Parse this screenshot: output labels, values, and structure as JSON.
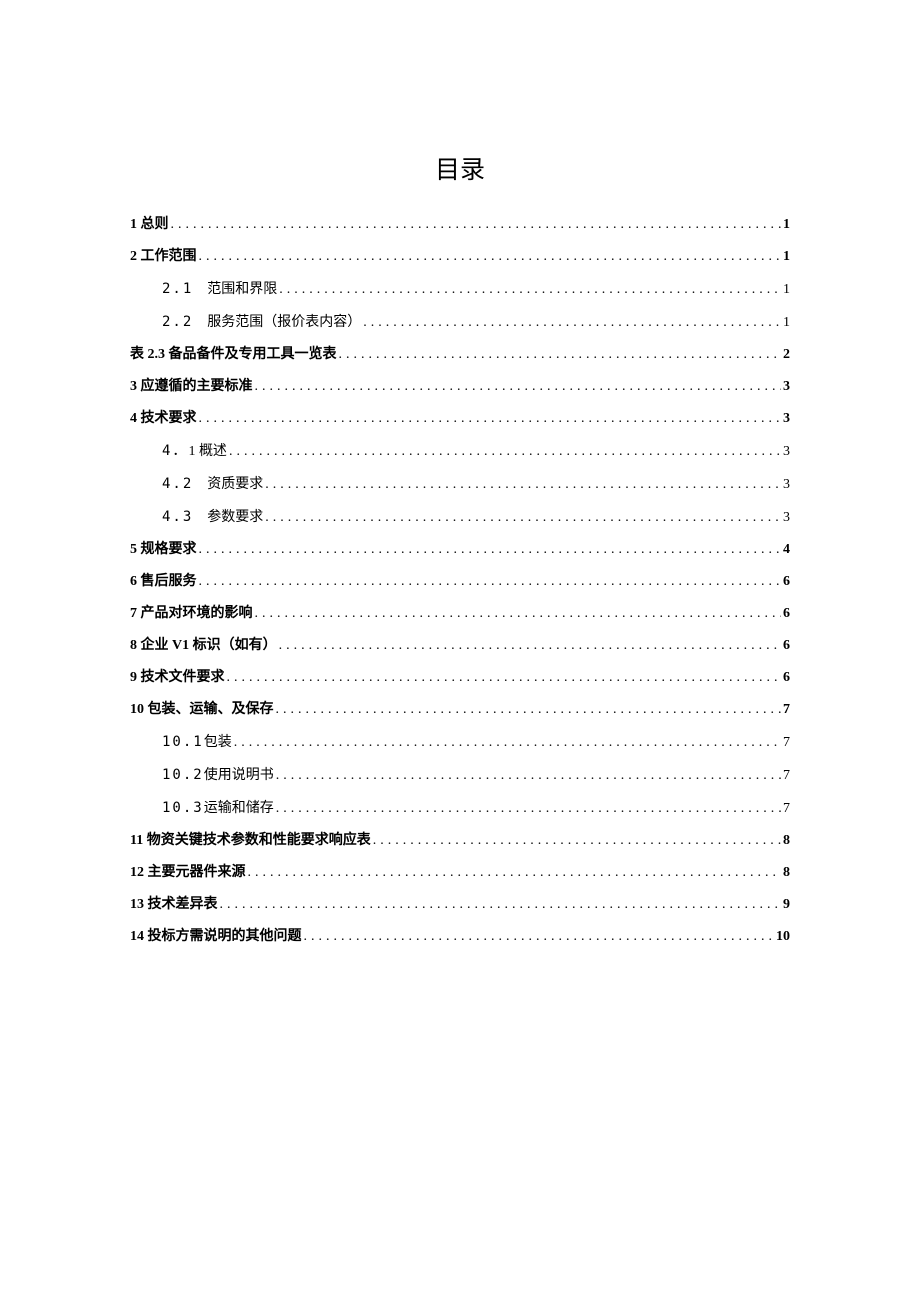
{
  "title": "目录",
  "toc": [
    {
      "level": 1,
      "label": "1 总则",
      "page": "1"
    },
    {
      "level": 1,
      "label": "2 工作范围",
      "page": "1"
    },
    {
      "level": 2,
      "num": "2.1",
      "label": "范围和界限",
      "page": "1"
    },
    {
      "level": 2,
      "num": "2.2",
      "label": "服务范围（报价表内容）",
      "page": "1"
    },
    {
      "level": 1,
      "label": "表 2.3 备品备件及专用工具一览表",
      "page": "2"
    },
    {
      "level": 1,
      "label": "3 应遵循的主要标准",
      "page": "3"
    },
    {
      "level": 1,
      "label": "4 技术要求",
      "page": "3"
    },
    {
      "level": 2,
      "num": "4．",
      "label": "1 概述",
      "page": "3",
      "tight": true
    },
    {
      "level": 2,
      "num": "4.2",
      "label": "资质要求",
      "page": "3"
    },
    {
      "level": 2,
      "num": "4.3",
      "label": "参数要求",
      "page": "3"
    },
    {
      "level": 1,
      "label": "5 规格要求",
      "page": "4"
    },
    {
      "level": 1,
      "label": "6 售后服务",
      "page": "6"
    },
    {
      "level": 1,
      "label": "7 产品对环境的影响",
      "page": "6"
    },
    {
      "level": 1,
      "label": "8 企业 V1 标识（如有）",
      "page": "6"
    },
    {
      "level": 1,
      "label": "9 技术文件要求",
      "page": "6"
    },
    {
      "level": 1,
      "label": "10 包装、运输、及保存",
      "page": "7"
    },
    {
      "level": 2,
      "num": "10.1",
      "label": "包装",
      "page": "7",
      "tight": true
    },
    {
      "level": 2,
      "num": "10.2",
      "label": "使用说明书",
      "page": "7",
      "tight": true
    },
    {
      "level": 2,
      "num": "10.3",
      "label": "运输和储存",
      "page": "7",
      "tight": true
    },
    {
      "level": 1,
      "label": "11 物资关键技术参数和性能要求响应表",
      "page": "8"
    },
    {
      "level": 1,
      "label": "12 主要元器件来源",
      "page": "8"
    },
    {
      "level": 1,
      "label": "13 技术差异表",
      "page": "9"
    },
    {
      "level": 1,
      "label": "14 投标方需说明的其他问题",
      "page": "10"
    }
  ]
}
